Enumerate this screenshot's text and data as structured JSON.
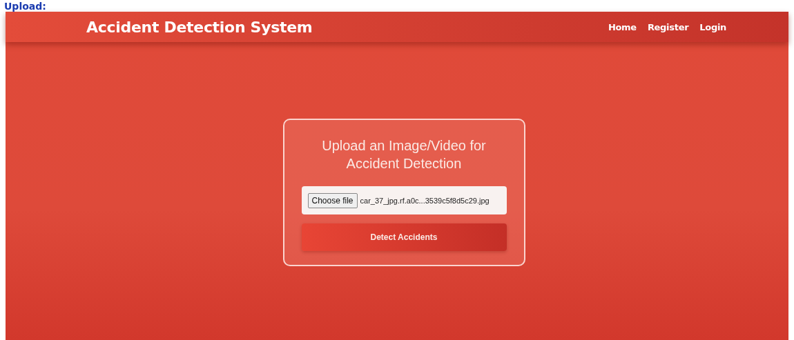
{
  "page_caption": "Upload:",
  "navbar": {
    "title": "Accident Detection System",
    "links": [
      {
        "label": "Home"
      },
      {
        "label": "Register"
      },
      {
        "label": "Login"
      }
    ]
  },
  "upload_card": {
    "heading": "Upload an Image/Video for Accident Detection",
    "file_input": {
      "button": "Choose file",
      "value": "car_37_jpg.rf.a0c...3539c5f8d5c29.jpg"
    },
    "submit": "Detect Accidents"
  }
}
